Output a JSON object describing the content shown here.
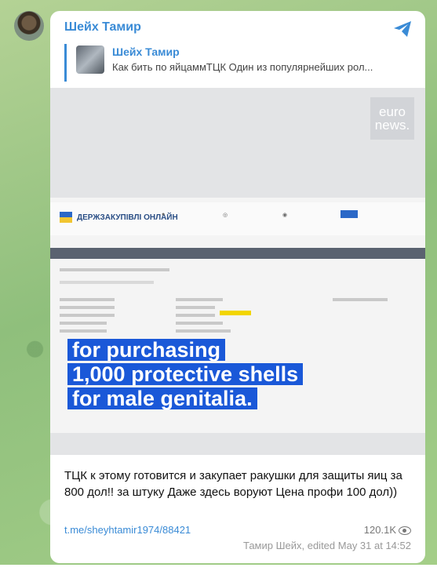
{
  "message": {
    "sender": "Шейх Тамир",
    "reply": {
      "name": "Шейх Тамир",
      "text": "Как бить по яйцаммТЦК Один из популярнейших рол..."
    },
    "media": {
      "logo": "euro news.",
      "site_logo": "ДЕРЖЗАКУПІВЛІ ОНЛАЙН",
      "caption_lines": [
        "for purchasing",
        "1,000 protective shells",
        "for male genitalia."
      ]
    },
    "text": "ТЦК к этому готовится и закупает ракушки для защиты яиц за 800 дол!! за штуку Даже здесь воруют Цена профи 100 дол))",
    "link": "t.me/sheyhtamir1974/88421",
    "views": "120.1K",
    "footer": "Тамир Шейх, edited  May 31 at 14:52",
    "accent": "#3a8bd6",
    "caption_bg": "#1a58d8"
  }
}
